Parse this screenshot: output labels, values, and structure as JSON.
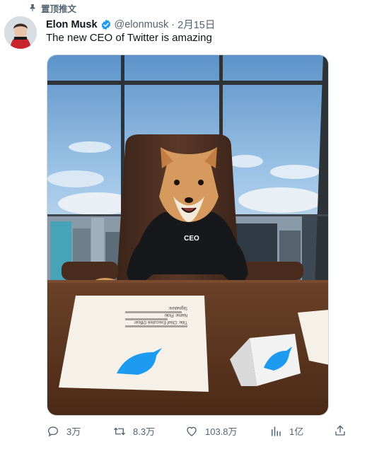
{
  "pinned": {
    "label": "置顶推文",
    "icon": "pin-icon"
  },
  "author": {
    "name": "Elon Musk",
    "handle": "@elonmusk",
    "separator": "·",
    "date": "2月15日",
    "verified_icon": "verified-badge-icon"
  },
  "tweet": {
    "text": "The new CEO of Twitter is amazing"
  },
  "media": {
    "sweater_text": "CEO",
    "paper_lines": [
      "Signature:",
      "Name: Floki",
      "Title: Chief Executive Officer"
    ]
  },
  "actions": {
    "reply": {
      "count": "3万",
      "icon": "reply-icon"
    },
    "retweet": {
      "count": "8.3万",
      "icon": "retweet-icon"
    },
    "like": {
      "count": "103.8万",
      "icon": "heart-icon"
    },
    "views": {
      "count": "1亿",
      "icon": "views-icon"
    },
    "share": {
      "icon": "share-icon"
    }
  },
  "colors": {
    "verified": "#1d9bf0",
    "text_secondary": "#536471",
    "twitter_blue": "#1d9bf0"
  }
}
